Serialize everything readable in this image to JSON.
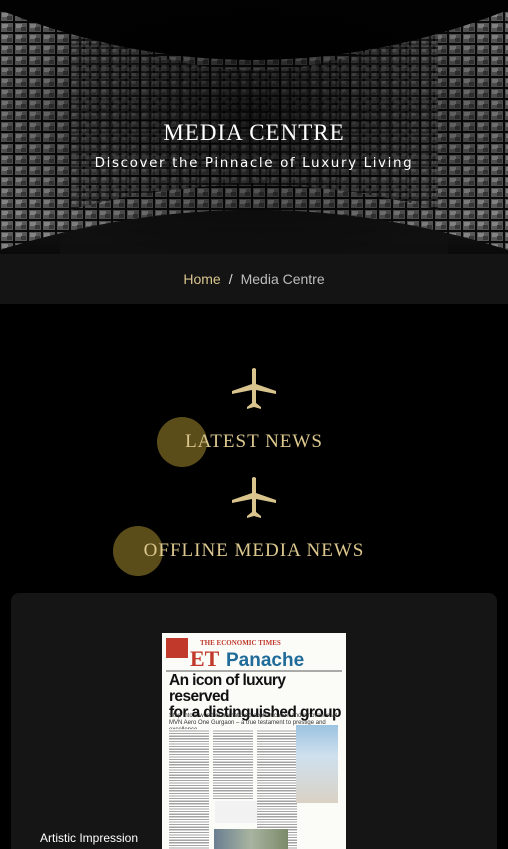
{
  "hero": {
    "title": "MEDIA CENTRE",
    "subtitle": "Discover the Pinnacle of Luxury Living"
  },
  "breadcrumb": {
    "home": "Home",
    "separator": "/",
    "current": "Media Centre"
  },
  "sections": {
    "latest_news": "LATEST NEWS",
    "offline_media_news": "OFFLINE MEDIA NEWS"
  },
  "card": {
    "caption": "Artistic Impression",
    "newspaper": {
      "masthead_top": "THE ECONOMIC TIMES",
      "brand_prefix": "ET",
      "brand_name": "Panache",
      "headline_line1": "An icon of luxury reserved",
      "headline_line2": "for a distinguished group",
      "deck": "Step into a world of unmatched sophistication and innovation at MVN Aero One Gurgaon – a true testament to prestige and excellence"
    }
  },
  "colors": {
    "gold": "#d8c48c",
    "gold_circle": "#6b5a1f",
    "background": "#000000",
    "breadcrumb_bg": "#141414",
    "card_bg": "#151515"
  },
  "icons": {
    "section_icon": "airplane-icon"
  }
}
